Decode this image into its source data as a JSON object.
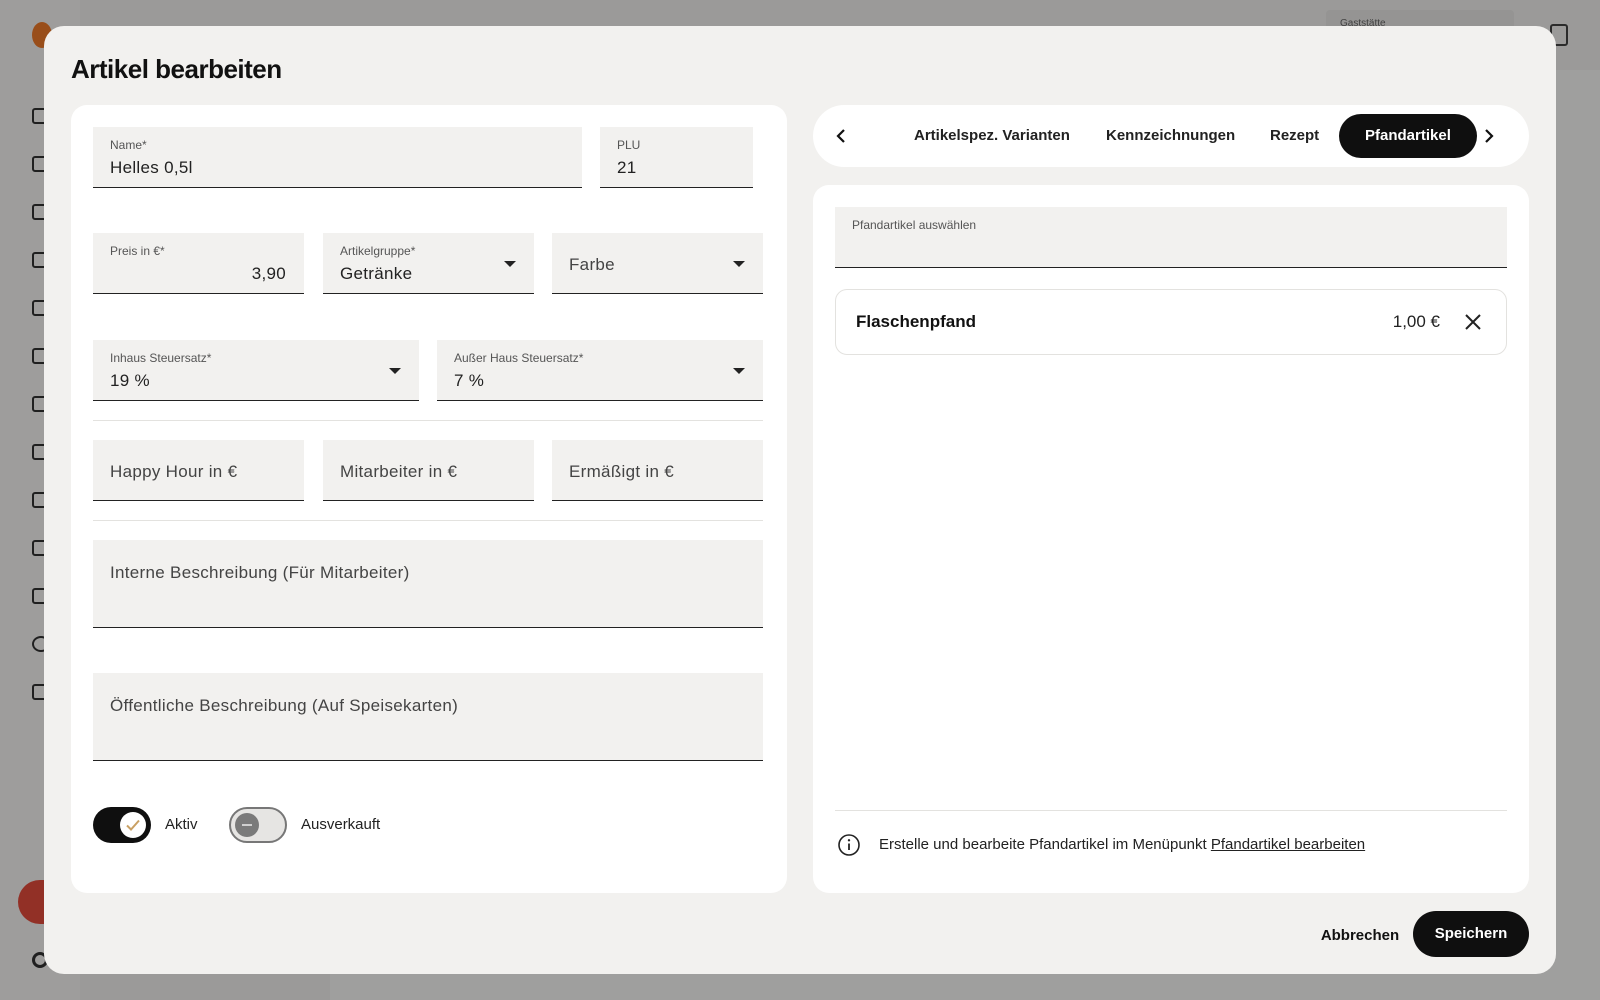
{
  "background": {
    "header_field_label": "Gaststätte"
  },
  "modal": {
    "title": "Artikel bearbeiten"
  },
  "form": {
    "name": {
      "label": "Name*",
      "value": "Helles 0,5l"
    },
    "plu": {
      "label": "PLU",
      "value": "21"
    },
    "price": {
      "label": "Preis in €*",
      "value": "3,90"
    },
    "article_group": {
      "label": "Artikelgruppe*",
      "value": "Getränke"
    },
    "color": {
      "placeholder": "Farbe"
    },
    "tax_inhouse": {
      "label": "Inhaus Steuersatz*",
      "value": "19 %"
    },
    "tax_outside": {
      "label": "Außer Haus Steuersatz*",
      "value": "7 %"
    },
    "happy_hour": {
      "placeholder": "Happy Hour in €"
    },
    "employee_price": {
      "placeholder": "Mitarbeiter in €"
    },
    "reduced_price": {
      "placeholder": "Ermäßigt in €"
    },
    "internal_description": {
      "placeholder": "Interne Beschreibung (Für Mitarbeiter)"
    },
    "public_description": {
      "placeholder": "Öffentliche Beschreibung (Auf Speisekarten)"
    },
    "toggles": {
      "active": {
        "label": "Aktiv",
        "on": true
      },
      "sold_out": {
        "label": "Ausverkauft",
        "on": false
      }
    }
  },
  "tabs": [
    {
      "label": "Artikelspez. Varianten",
      "active": false
    },
    {
      "label": "Kennzeichnungen",
      "active": false
    },
    {
      "label": "Rezept",
      "active": false
    },
    {
      "label": "Pfandartikel",
      "active": true
    }
  ],
  "deposit": {
    "select_label": "Pfandartikel auswählen",
    "items": [
      {
        "name": "Flaschenpfand",
        "price": "1,00 €"
      }
    ],
    "info_text": "Erstelle und bearbeite Pfandartikel im Menüpunkt ",
    "info_link": "Pfandartikel bearbeiten"
  },
  "actions": {
    "cancel": "Abbrechen",
    "save": "Speichern"
  },
  "colors": {
    "accent": "#0f0f0f",
    "field_bg": "#f2f1ef",
    "logo": "#f07a2a",
    "fab": "#e54b3c"
  }
}
